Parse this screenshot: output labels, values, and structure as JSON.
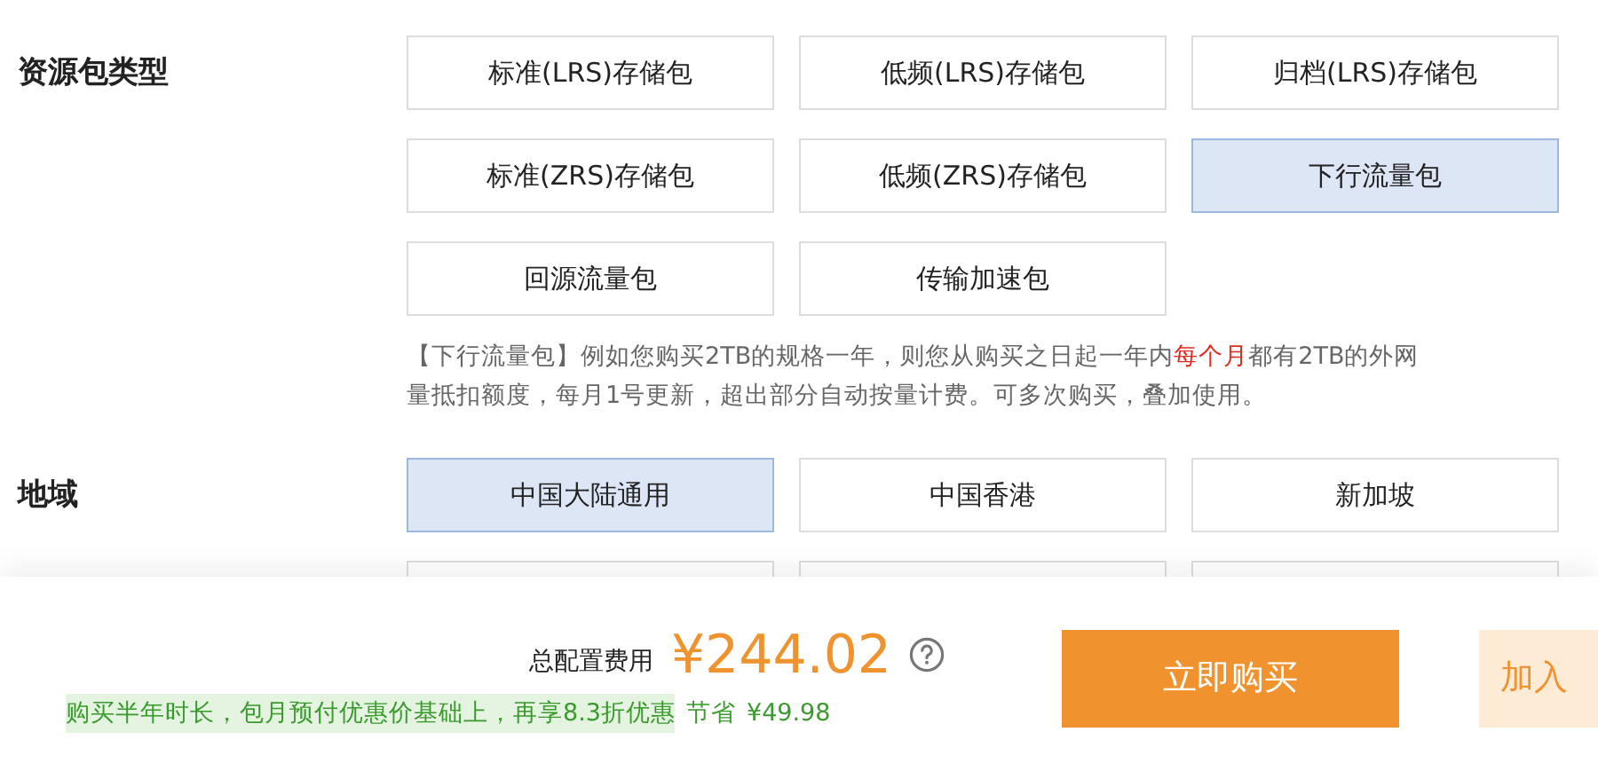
{
  "package_type": {
    "label": "资源包类型",
    "options": [
      {
        "label": "标准(LRS)存储包",
        "selected": false
      },
      {
        "label": "低频(LRS)存储包",
        "selected": false
      },
      {
        "label": "归档(LRS)存储包",
        "selected": false
      },
      {
        "label": "标准(ZRS)存储包",
        "selected": false
      },
      {
        "label": "低频(ZRS)存储包",
        "selected": false
      },
      {
        "label": "下行流量包",
        "selected": true
      },
      {
        "label": "回源流量包",
        "selected": false
      },
      {
        "label": "传输加速包",
        "selected": false
      }
    ],
    "description": {
      "line_1": [
        {
          "text": "【下行流量包】例如您购买2TB的规格一年，则您从购买之日起一年内",
          "emphasis": false
        },
        {
          "text": "每个月",
          "emphasis": true
        },
        {
          "text": "都有2TB的外网",
          "emphasis": false
        }
      ],
      "line_2": "量抵扣额度，每月1号更新，超出部分自动按量计费。可多次购买，叠加使用。"
    }
  },
  "region": {
    "label": "地域",
    "options": [
      {
        "label": "中国大陆通用",
        "selected": true
      },
      {
        "label": "中国香港",
        "selected": false
      },
      {
        "label": "新加坡",
        "selected": false
      }
    ]
  },
  "footer": {
    "total_label": "总配置费用",
    "price": "¥244.02",
    "promo": "购买半年时长，包月预付优惠价基础上，再享8.3折优惠",
    "savings_label": "节省",
    "savings": "¥49.98",
    "buy_button": "立即购买",
    "cart_button": "加入"
  }
}
